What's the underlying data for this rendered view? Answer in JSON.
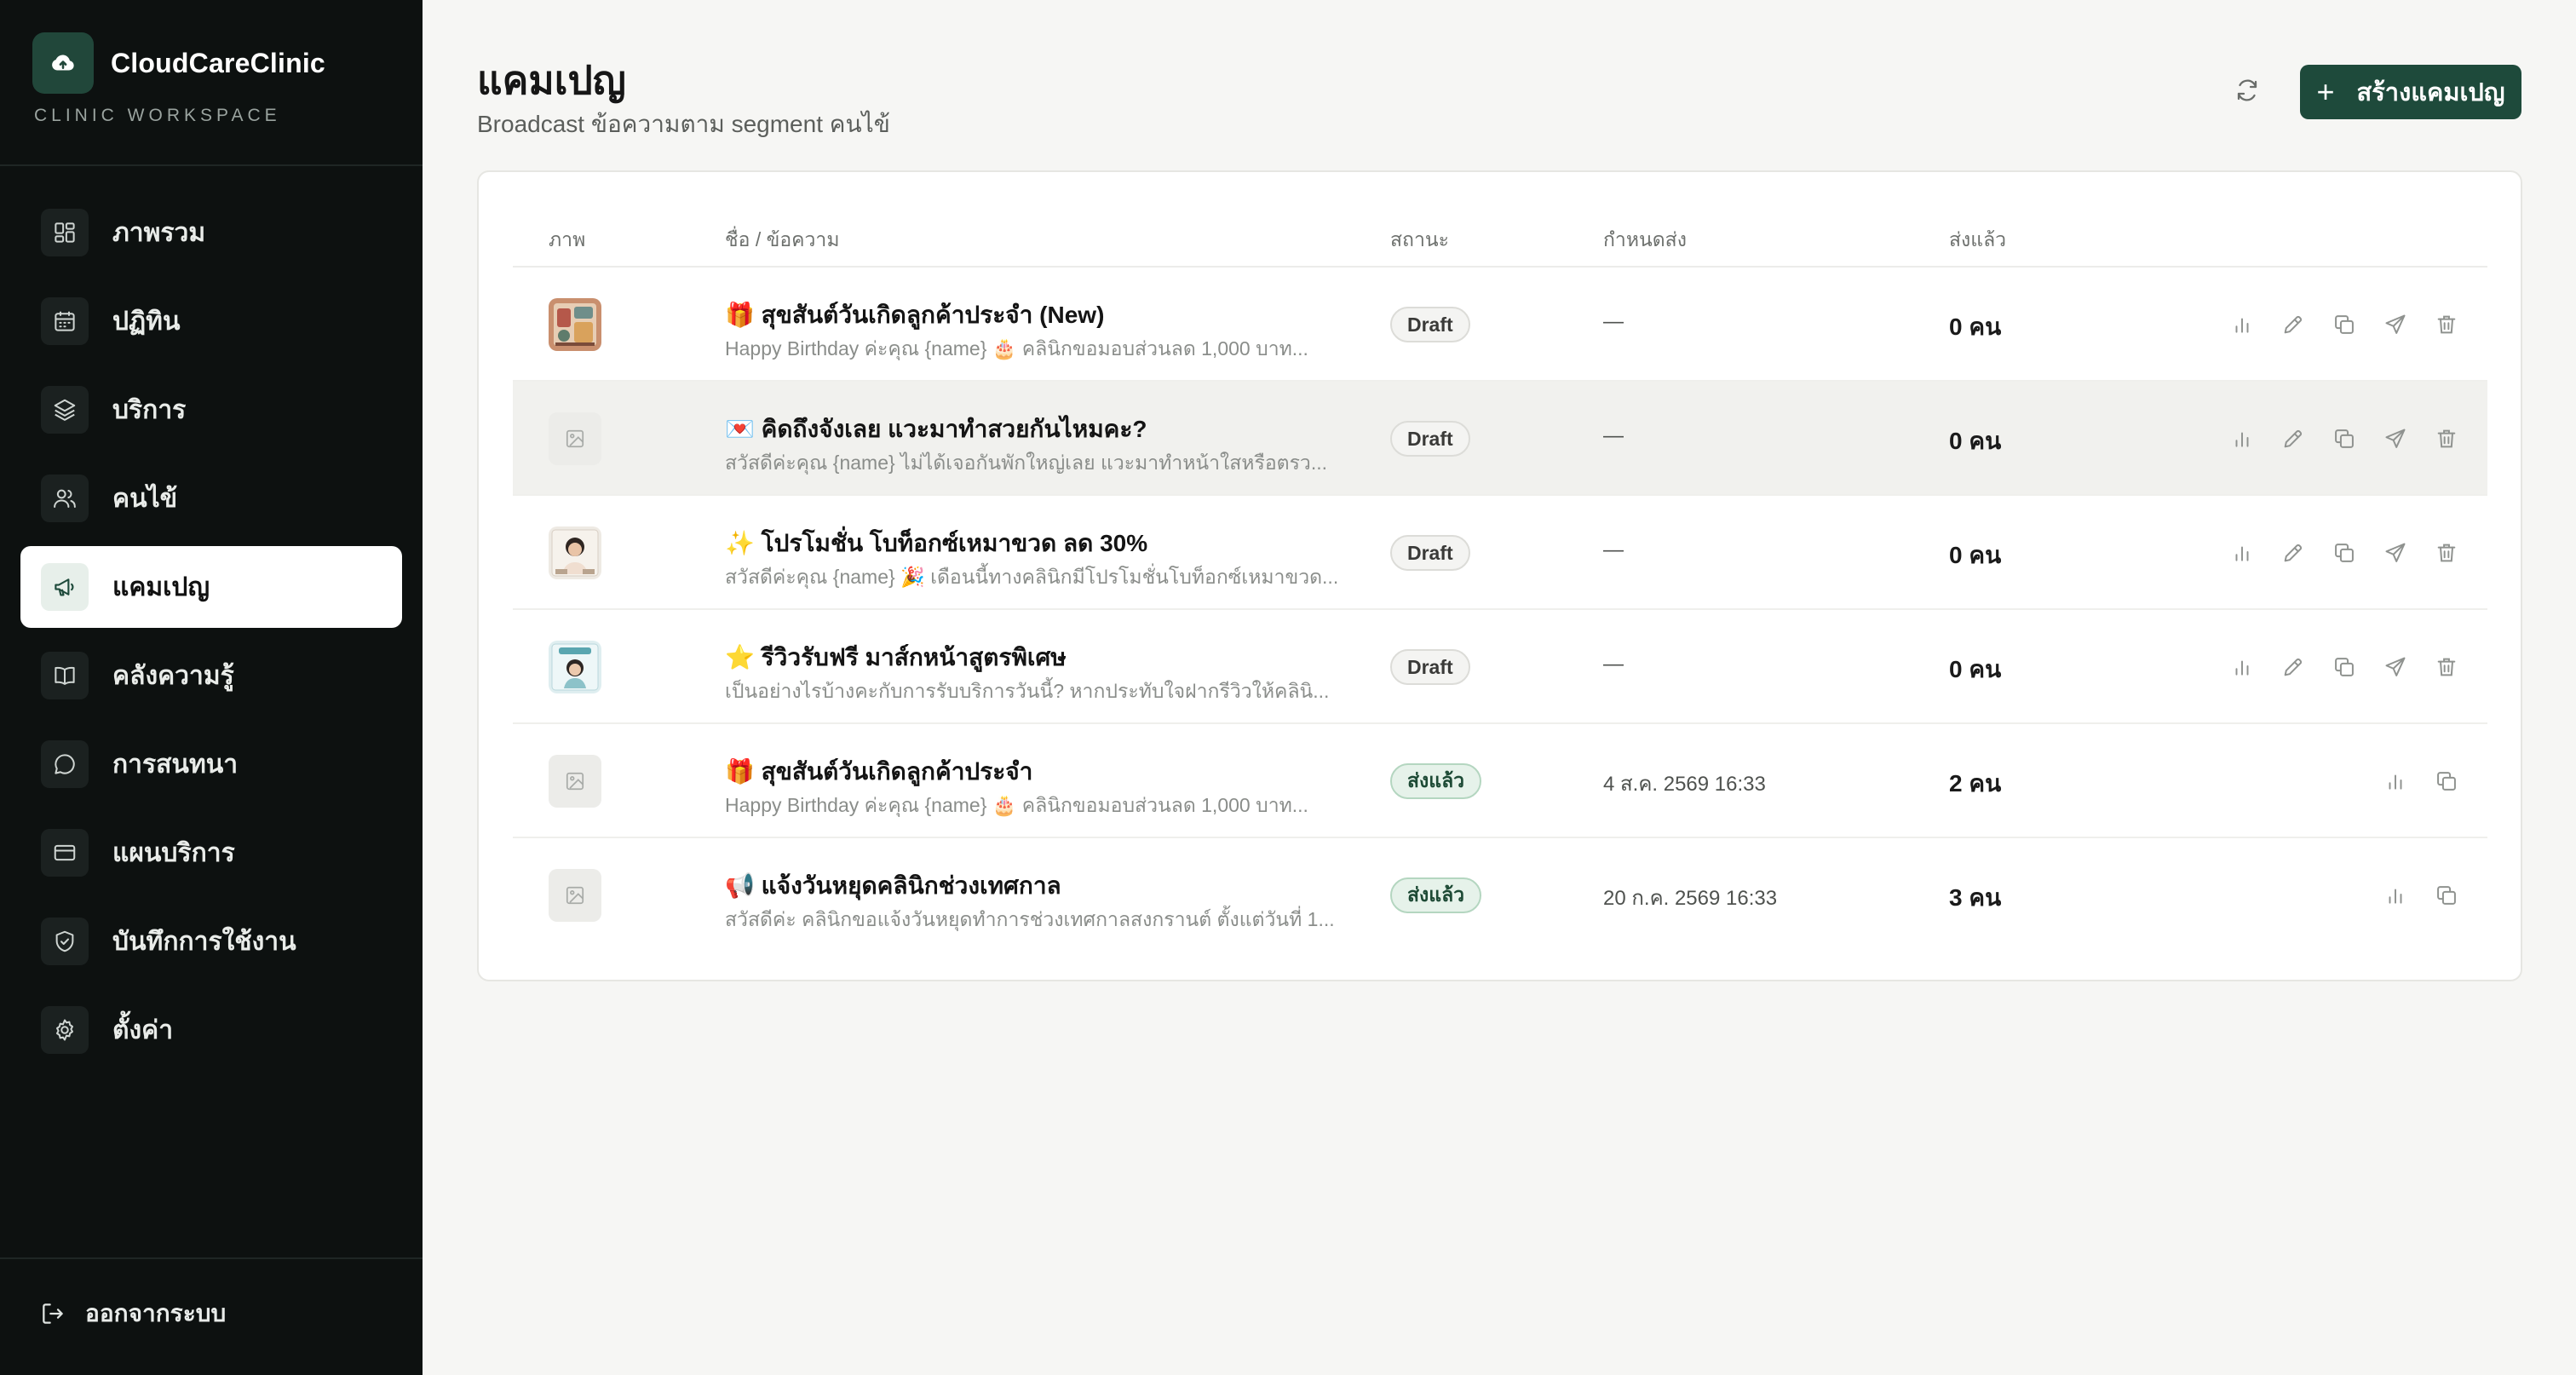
{
  "app": {
    "name": "CloudCareClinic",
    "subtitle": "CLINIC WORKSPACE",
    "logo_icon": "cloud-upload-icon"
  },
  "sidebar": {
    "items": [
      {
        "label": "ภาพรวม",
        "icon": "dashboard-icon",
        "active": false
      },
      {
        "label": "ปฏิทิน",
        "icon": "calendar-icon",
        "active": false
      },
      {
        "label": "บริการ",
        "icon": "layers-icon",
        "active": false
      },
      {
        "label": "คนไข้",
        "icon": "users-icon",
        "active": false
      },
      {
        "label": "แคมเปญ",
        "icon": "megaphone-icon",
        "active": true
      },
      {
        "label": "คลังความรู้",
        "icon": "book-icon",
        "active": false
      },
      {
        "label": "การสนทนา",
        "icon": "chat-icon",
        "active": false
      },
      {
        "label": "แผนบริการ",
        "icon": "credit-card-icon",
        "active": false
      },
      {
        "label": "บันทึกการใช้งาน",
        "icon": "shield-icon",
        "active": false
      },
      {
        "label": "ตั้งค่า",
        "icon": "gear-icon",
        "active": false
      }
    ],
    "logout_label": "ออกจากระบบ"
  },
  "header": {
    "title": "แคมเปญ",
    "subtitle": "Broadcast ข้อความตาม segment คนไข้",
    "create_label": "สร้างแคมเปญ"
  },
  "table": {
    "columns": {
      "image": "ภาพ",
      "name": "ชื่อ / ข้อความ",
      "status": "สถานะ",
      "schedule": "กำหนดส่ง",
      "sent": "ส่งแล้ว"
    },
    "rows": [
      {
        "title": "🎁 สุขสันต์วันเกิดลูกค้าประจำ (New)",
        "message": "Happy Birthday ค่ะคุณ {name} 🎂 คลินิกขอมอบส่วนลด 1,000 บาท...",
        "status": "Draft",
        "schedule": "—",
        "sent": "0 คน",
        "image": "photo"
      },
      {
        "title": "💌 คิดถึงจังเลย แวะมาทำสวยกันไหมคะ?",
        "message": "สวัสดีค่ะคุณ {name} ไม่ได้เจอกันพักใหญ่เลย แวะมาทำหน้าใสหรือตรว...",
        "status": "Draft",
        "schedule": "—",
        "sent": "0 คน",
        "image": "placeholder"
      },
      {
        "title": "✨ โปรโมชั่น โบท็อกซ์เหมาขวด ลด 30%",
        "message": "สวัสดีค่ะคุณ {name} 🎉 เดือนนี้ทางคลินิกมีโปรโมชั่นโบท็อกซ์เหมาขวด...",
        "status": "Draft",
        "schedule": "—",
        "sent": "0 คน",
        "image": "photo"
      },
      {
        "title": "⭐ รีวิวรับฟรี มาส์กหน้าสูตรพิเศษ",
        "message": "เป็นอย่างไรบ้างคะกับการรับบริการวันนี้? หากประทับใจฝากรีวิวให้คลินิ...",
        "status": "Draft",
        "schedule": "—",
        "sent": "0 คน",
        "image": "photo"
      },
      {
        "title": "🎁 สุขสันต์วันเกิดลูกค้าประจำ",
        "message": "Happy Birthday ค่ะคุณ {name} 🎂 คลินิกขอมอบส่วนลด 1,000 บาท...",
        "status": "ส่งแล้ว",
        "schedule": "4 ส.ค. 2569 16:33",
        "sent": "2 คน",
        "image": "placeholder"
      },
      {
        "title": "📢 แจ้งวันหยุดคลินิกช่วงเทศกาล",
        "message": "สวัสดีค่ะ คลินิกขอแจ้งวันหยุดทำการช่วงเทศกาลสงกรานต์ ตั้งแต่วันที่ 1...",
        "status": "ส่งแล้ว",
        "schedule": "20 ก.ค. 2569 16:33",
        "sent": "3 คน",
        "image": "placeholder"
      }
    ]
  },
  "colors": {
    "sidebar_bg": "#0d1110",
    "accent": "#1e4a3b",
    "page_bg": "#f6f6f4"
  }
}
